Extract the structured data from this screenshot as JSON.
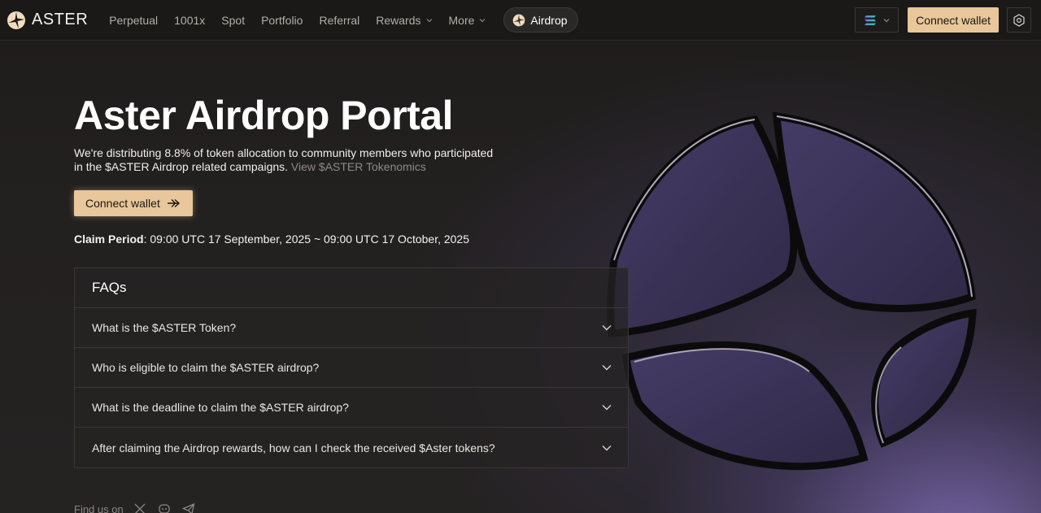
{
  "brand": {
    "name": "ASTER",
    "logo_icon": "aster-logo-icon"
  },
  "nav": {
    "links": [
      {
        "label": "Perpetual"
      },
      {
        "label": "1001x"
      },
      {
        "label": "Spot"
      },
      {
        "label": "Portfolio"
      },
      {
        "label": "Referral"
      },
      {
        "label": "Rewards",
        "dropdown": true
      },
      {
        "label": "More",
        "dropdown": true
      }
    ],
    "airdrop_label": "Airdrop",
    "chain_icon": "solana-icon",
    "connect_label": "Connect wallet",
    "settings_icon": "settings-icon"
  },
  "hero": {
    "title": "Aster Airdrop Portal",
    "description": "We're distributing 8.8% of token allocation to community members who participated in the $ASTER Airdrop related campaigns.",
    "tokenomics_link": "View $ASTER Tokenomics",
    "connect_label": "Connect wallet",
    "claim_label": "Claim Period",
    "claim_value": ": 09:00 UTC 17 September, 2025 ~ 09:00 UTC 17 October, 2025"
  },
  "faq": {
    "title": "FAQs",
    "items": [
      {
        "question": "What is the $ASTER Token?"
      },
      {
        "question": "Who is eligible to claim the $ASTER airdrop?"
      },
      {
        "question": "What is the deadline to claim the $ASTER airdrop?"
      },
      {
        "question": "After claiming the Airdrop rewards, how can I check the received $Aster tokens?"
      }
    ]
  },
  "footer": {
    "find_us_label": "Find us on",
    "social_icons": [
      "x-icon",
      "discord-icon",
      "telegram-icon"
    ]
  },
  "colors": {
    "accent": "#e9c79a",
    "background": "#1b1918",
    "purple_glow": "#8c78c8"
  }
}
